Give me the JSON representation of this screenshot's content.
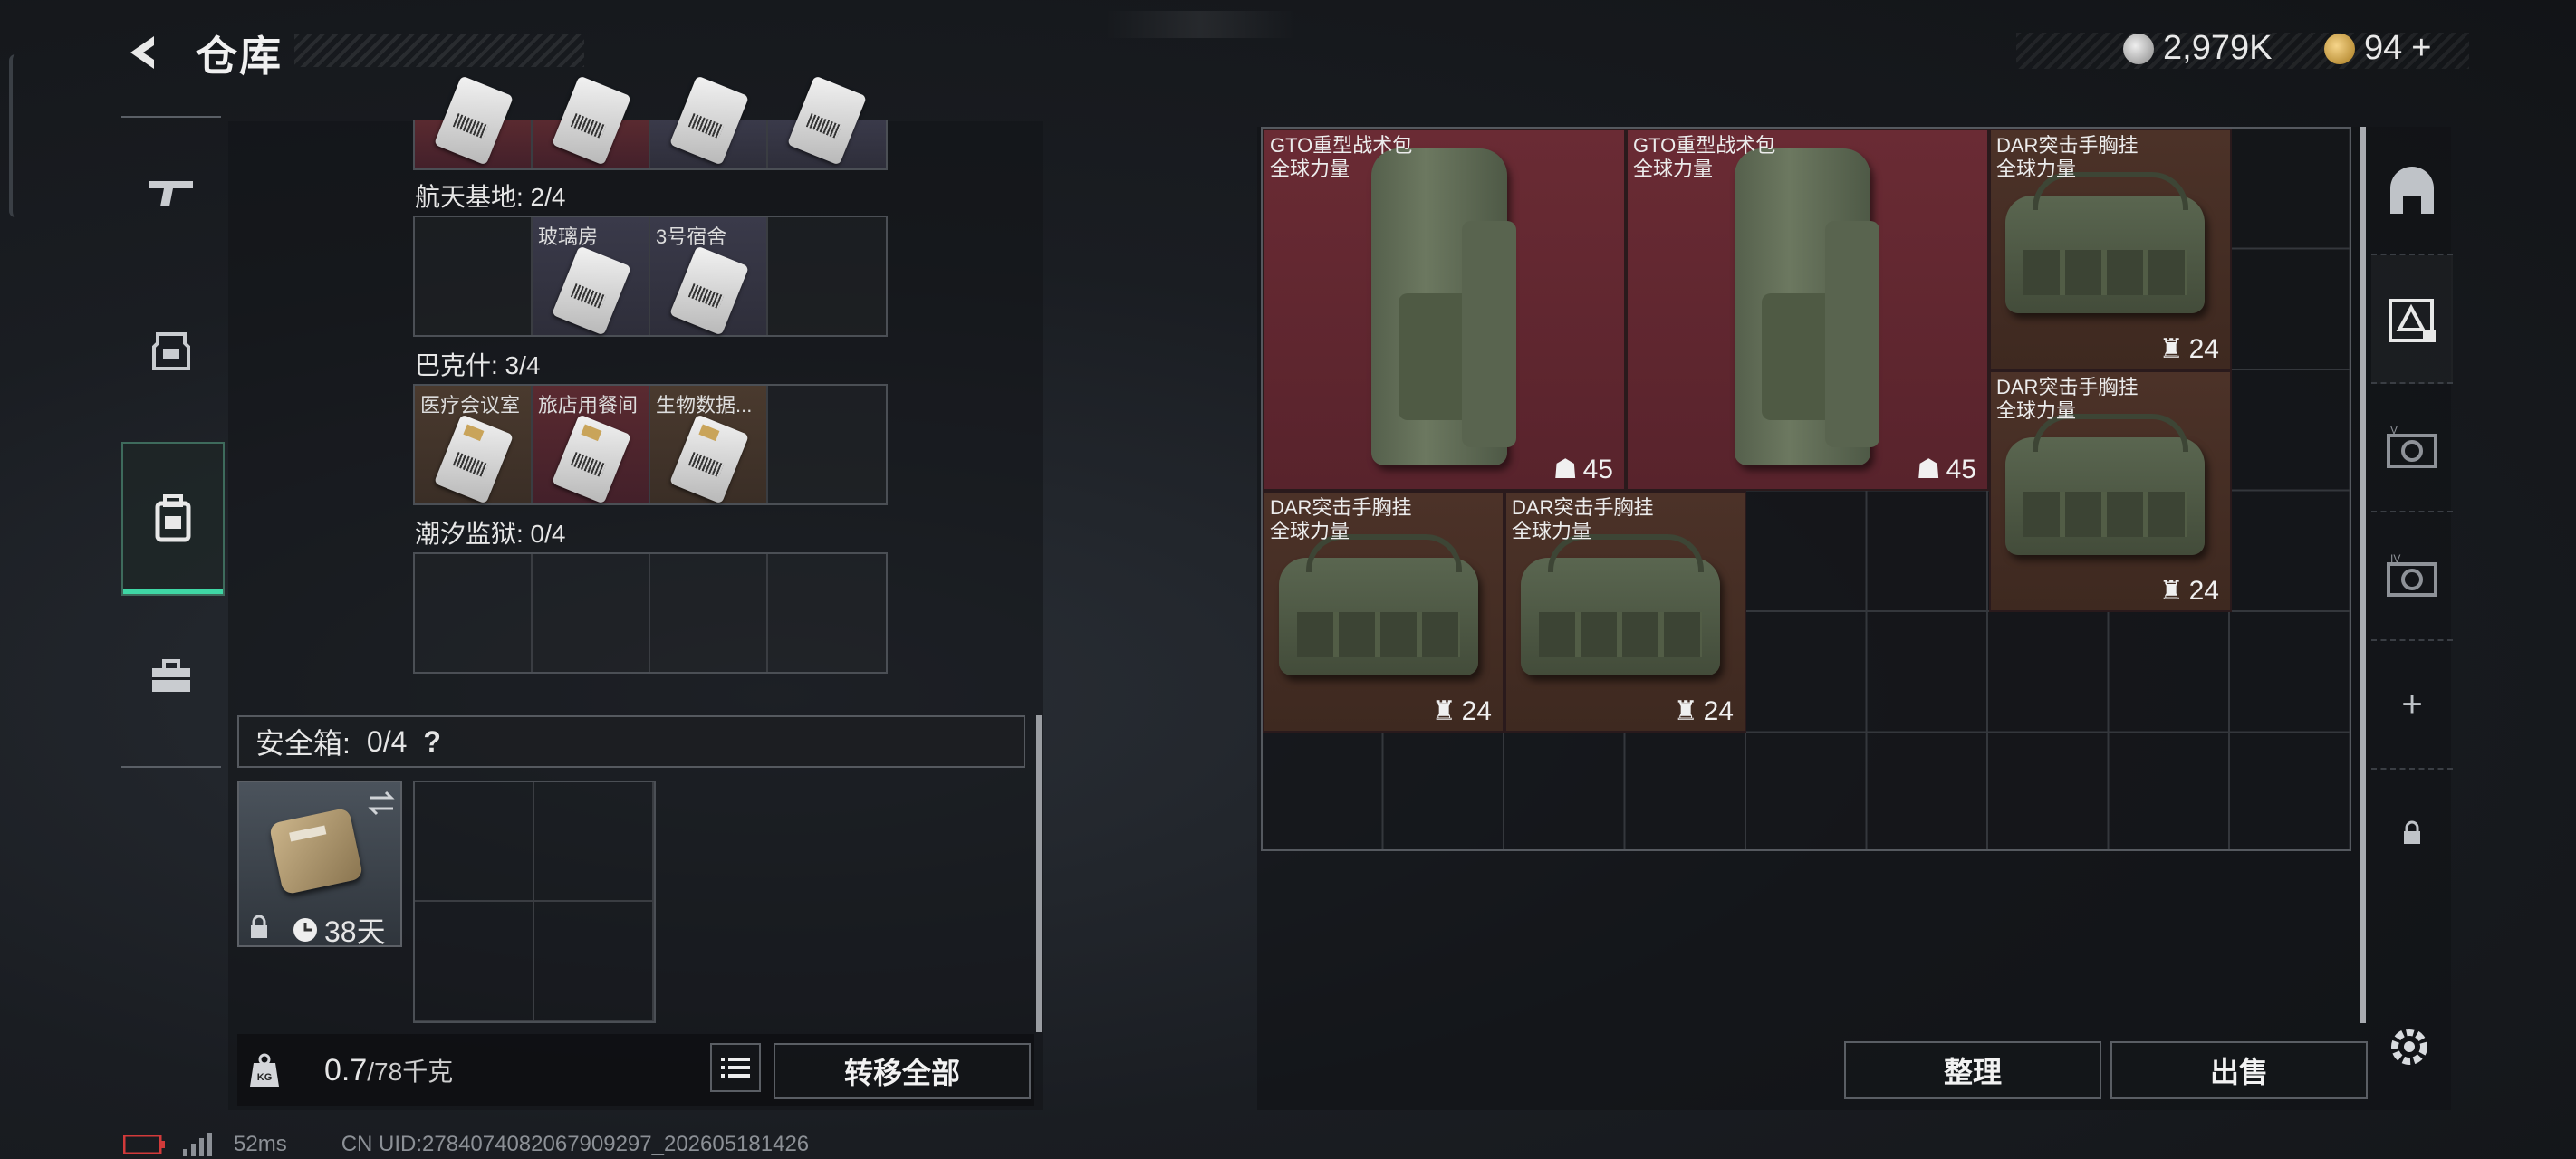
{
  "header": {
    "title": "仓库"
  },
  "currency": [
    {
      "icon": "silver-coin-icon",
      "value": "2,979K"
    },
    {
      "icon": "gold-coin-icon",
      "value": "94",
      "suffix": "+"
    }
  ],
  "left_nav": [
    "pistol-icon",
    "armor-icon",
    "backpack-icon",
    "toolbox-icon"
  ],
  "keys": {
    "sections": [
      {
        "label": "航天基地: 2/4",
        "cells": [
          {
            "name": ""
          },
          {
            "name": "玻璃房",
            "color": "key"
          },
          {
            "name": "3号宿舍",
            "color": "key"
          },
          {
            "name": ""
          }
        ]
      },
      {
        "label": "巴克什: 3/4",
        "cells": [
          {
            "name": "医疗会议室",
            "color": "tan"
          },
          {
            "name": "旅店用餐间",
            "color": "red"
          },
          {
            "name": "生物数据...",
            "color": "tan"
          },
          {
            "name": ""
          }
        ]
      },
      {
        "label": "潮汐监狱: 0/4",
        "cells": [
          {
            "name": ""
          },
          {
            "name": ""
          },
          {
            "name": ""
          },
          {
            "name": ""
          }
        ]
      }
    ]
  },
  "secure_box": {
    "label": "安全箱:",
    "count": "0/4",
    "help": "?",
    "expiry": "38天"
  },
  "weight": {
    "current": "0.7",
    "max": "/78千克",
    "icon": "weight-kg-icon"
  },
  "buttons": {
    "transfer_all": "转移全部",
    "organize": "整理",
    "sell": "出售"
  },
  "stash_items": [
    {
      "name": "GTO重型战术包",
      "sub": "全球力量",
      "count": "45",
      "kind": "backpack"
    },
    {
      "name": "GTO重型战术包",
      "sub": "全球力量",
      "count": "45",
      "kind": "backpack"
    },
    {
      "name": "DAR突击手胸挂",
      "sub": "全球力量",
      "count": "24",
      "kind": "rig"
    },
    {
      "name": "DAR突击手胸挂",
      "sub": "全球力量",
      "count": "24",
      "kind": "rig"
    },
    {
      "name": "DAR突击手胸挂",
      "sub": "全球力量",
      "count": "24",
      "kind": "rig"
    },
    {
      "name": "DAR突击手胸挂",
      "sub": "全球力量",
      "count": "24",
      "kind": "rig"
    }
  ],
  "right_tools": [
    "stash-tab-1-icon",
    "stash-tab-2-icon",
    "stash-tab-3-icon",
    "stash-tab-4-icon",
    "add-icon",
    "lock-icon"
  ],
  "status": {
    "ping": "52ms",
    "uid": "CN UID:2784074082067909297_202605181426"
  },
  "colors": {
    "accent": "#3fd7a5",
    "backpack_bg": "#6a2b34",
    "rig_bg": "#4c3228"
  }
}
